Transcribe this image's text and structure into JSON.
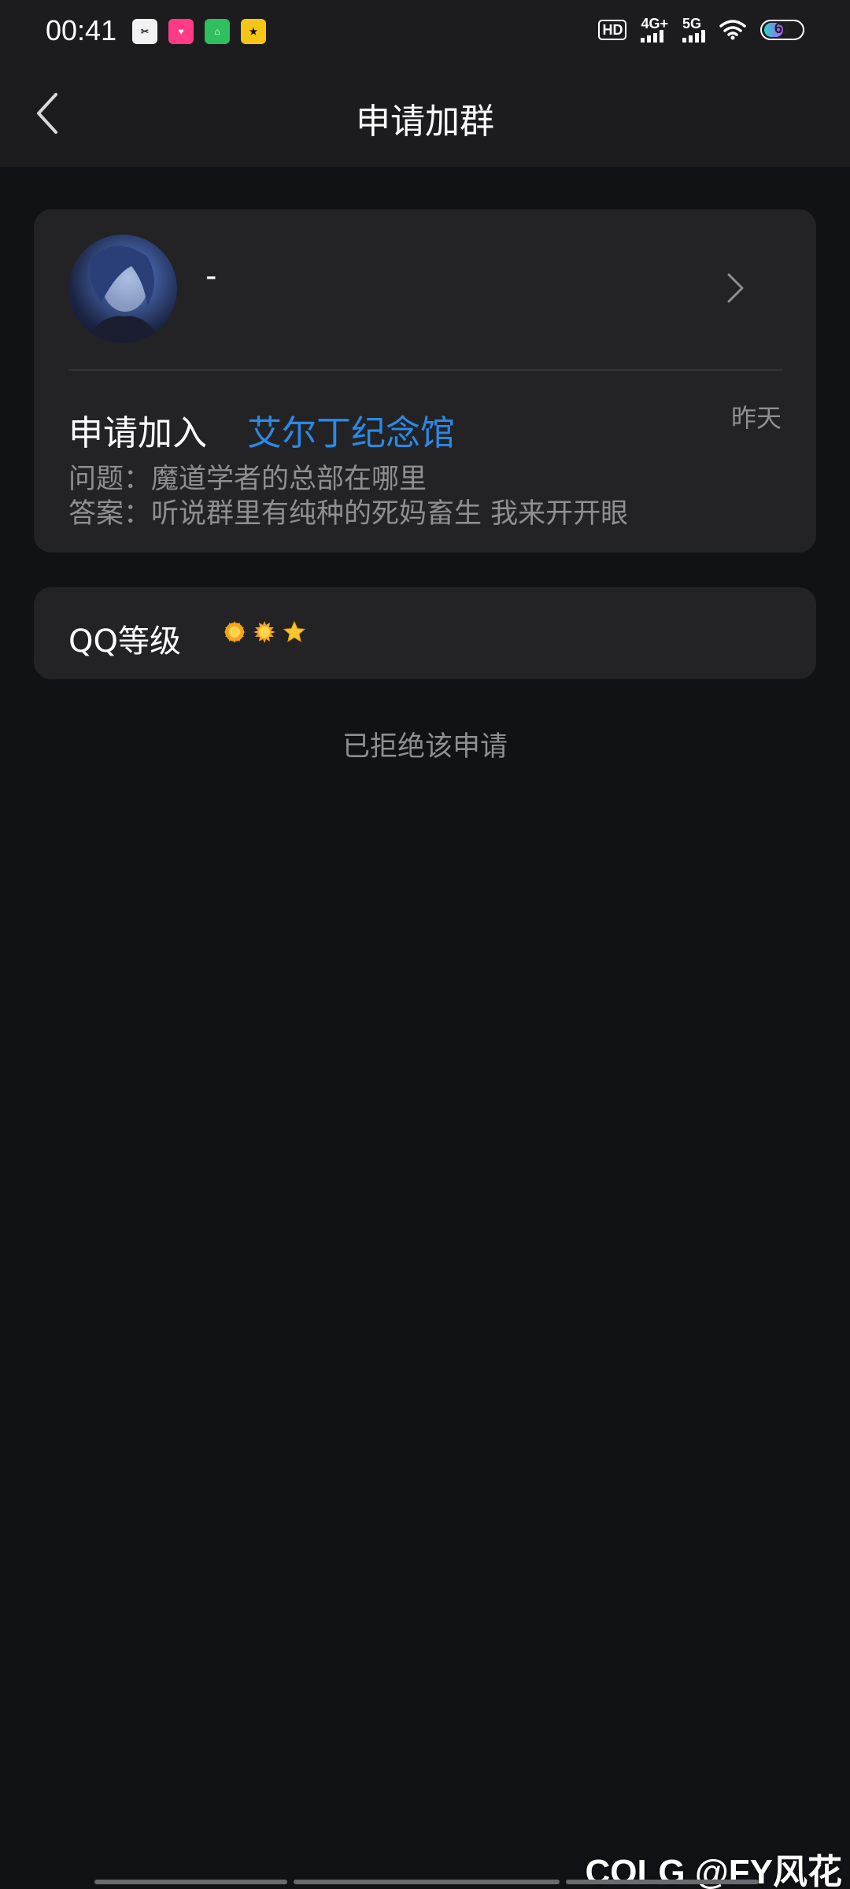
{
  "status_bar": {
    "time": "00:41",
    "hd_label": "HD",
    "network_1": "4G+",
    "network_2": "5G",
    "battery_level": "61"
  },
  "nav": {
    "title": "申请加群",
    "back_icon": "chevron-left-icon"
  },
  "request": {
    "nickname": "-",
    "apply_label": "申请加入",
    "group_name": "艾尔丁纪念馆",
    "time": "昨天",
    "question": "问题：魔道学者的总部在哪里",
    "answer": "答案：听说群里有纯种的死妈畜生 我来开开眼"
  },
  "level": {
    "label": "QQ等级",
    "icons": [
      "sun-icon",
      "sun-icon",
      "star-icon"
    ]
  },
  "status_text": "已拒绝该申请",
  "watermark": "COLG @FY风花",
  "colors": {
    "background": "#111215",
    "card": "#232326",
    "accent_link": "#2b89e6",
    "secondary_text": "#8e8e93"
  }
}
